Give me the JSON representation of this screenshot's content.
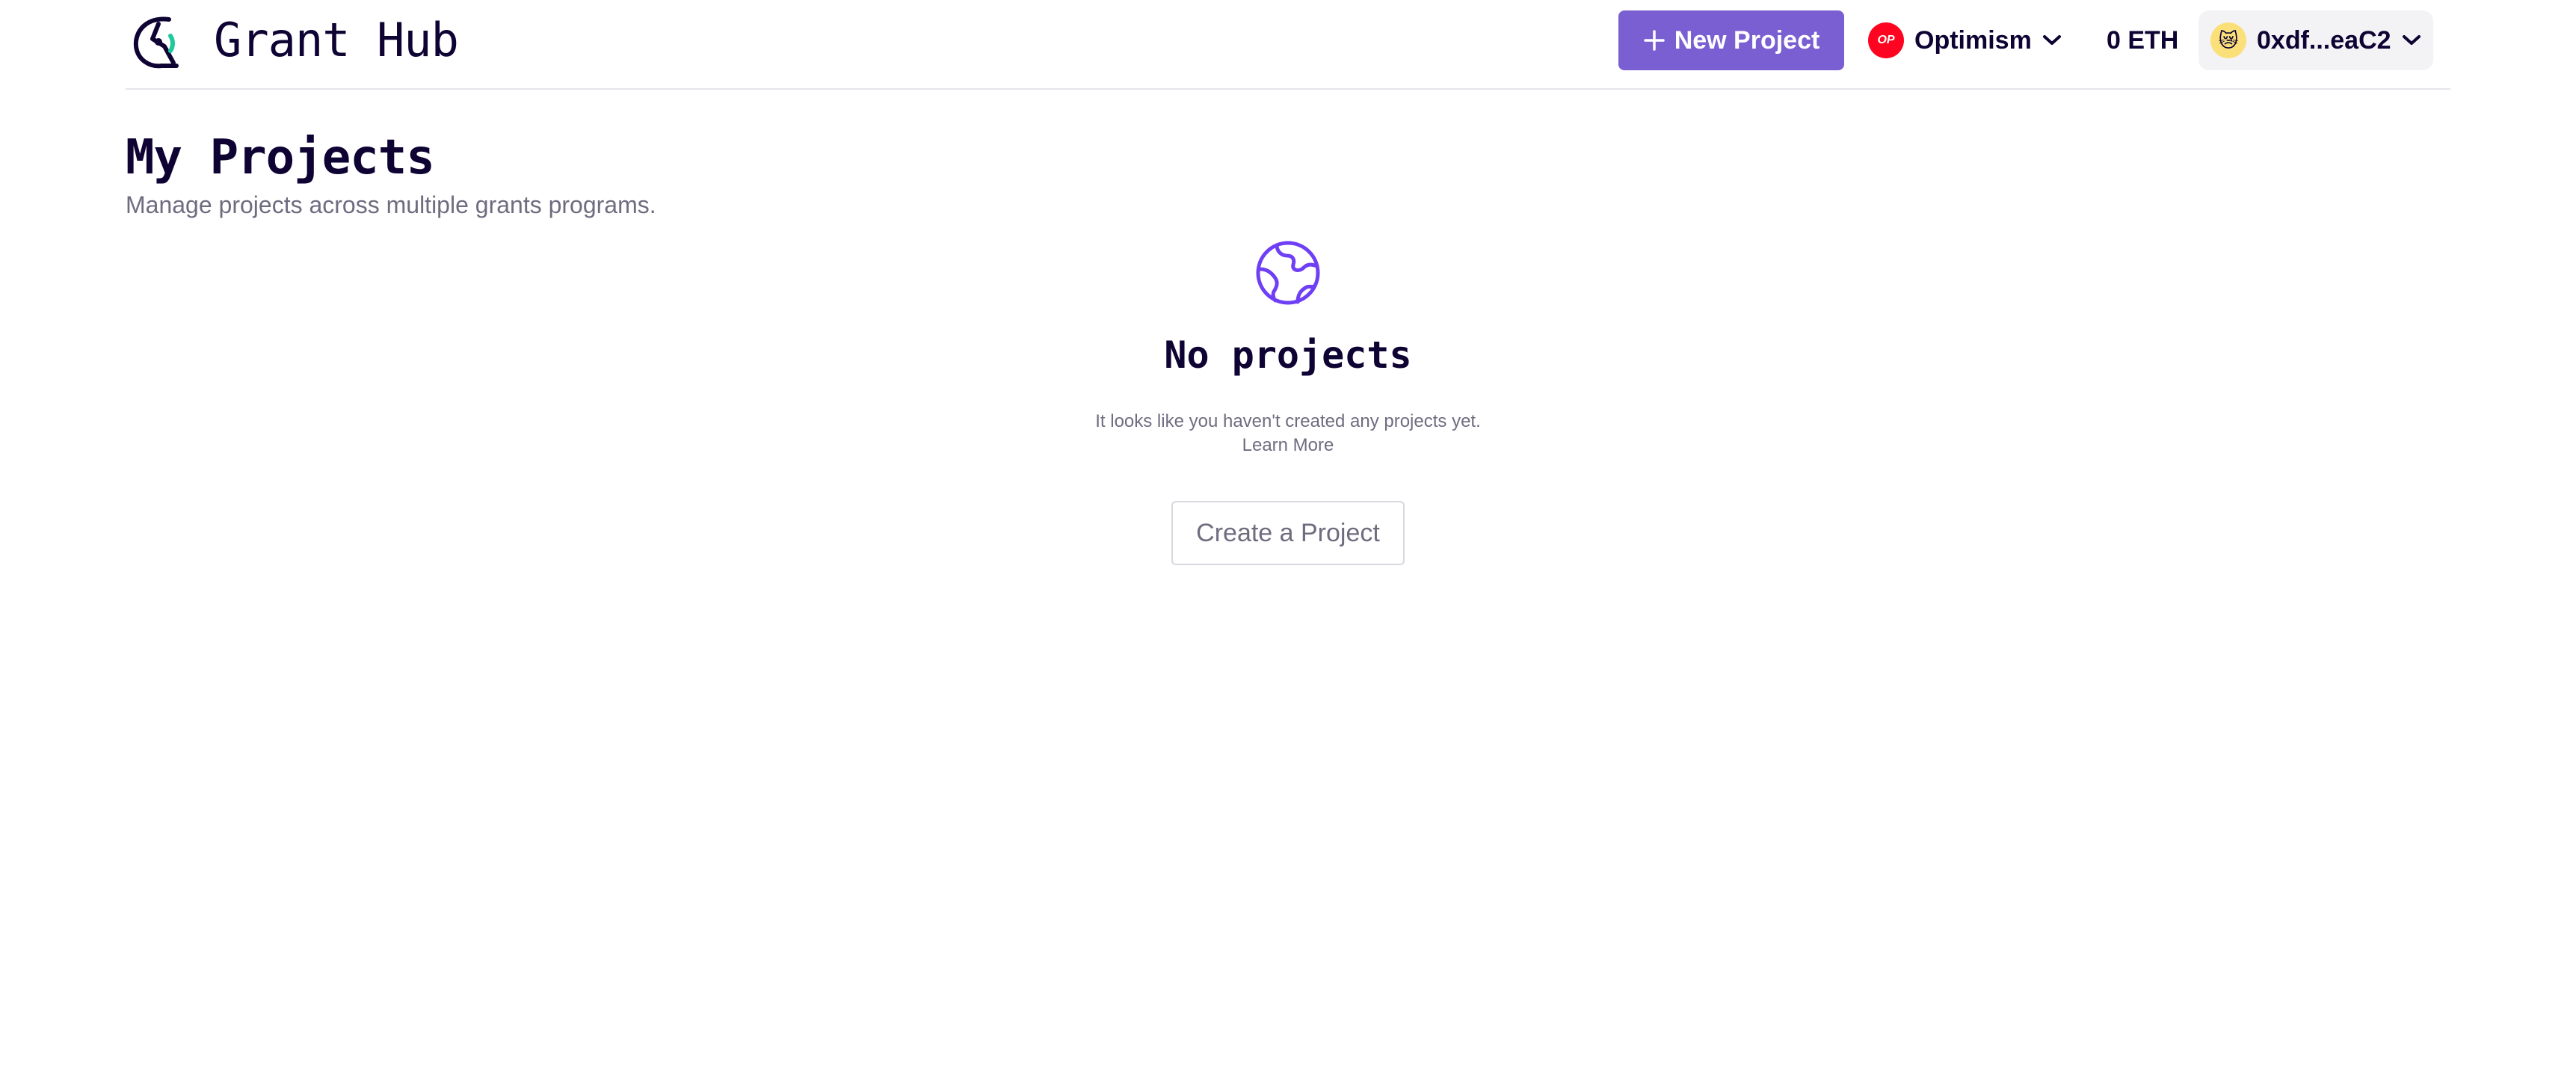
{
  "header": {
    "app_title": "Grant Hub",
    "new_project_label": "New Project",
    "network": {
      "badge": "OP",
      "name": "Optimism"
    },
    "balance": "0 ETH",
    "account": {
      "address": "0xdf...eaC2",
      "avatar_emoji": "😿"
    }
  },
  "main": {
    "title": "My Projects",
    "subtitle": "Manage projects across multiple grants programs.",
    "empty_state": {
      "title": "No projects",
      "description": "It looks like you haven't created any projects yet.",
      "learn_more": "Learn More",
      "create_button": "Create a Project"
    }
  },
  "colors": {
    "accent": "#7a5fd3",
    "text_primary": "#0e0333",
    "text_muted": "#6f6c80",
    "optimism_red": "#ff0420",
    "globe_icon": "#6f3ff5"
  }
}
